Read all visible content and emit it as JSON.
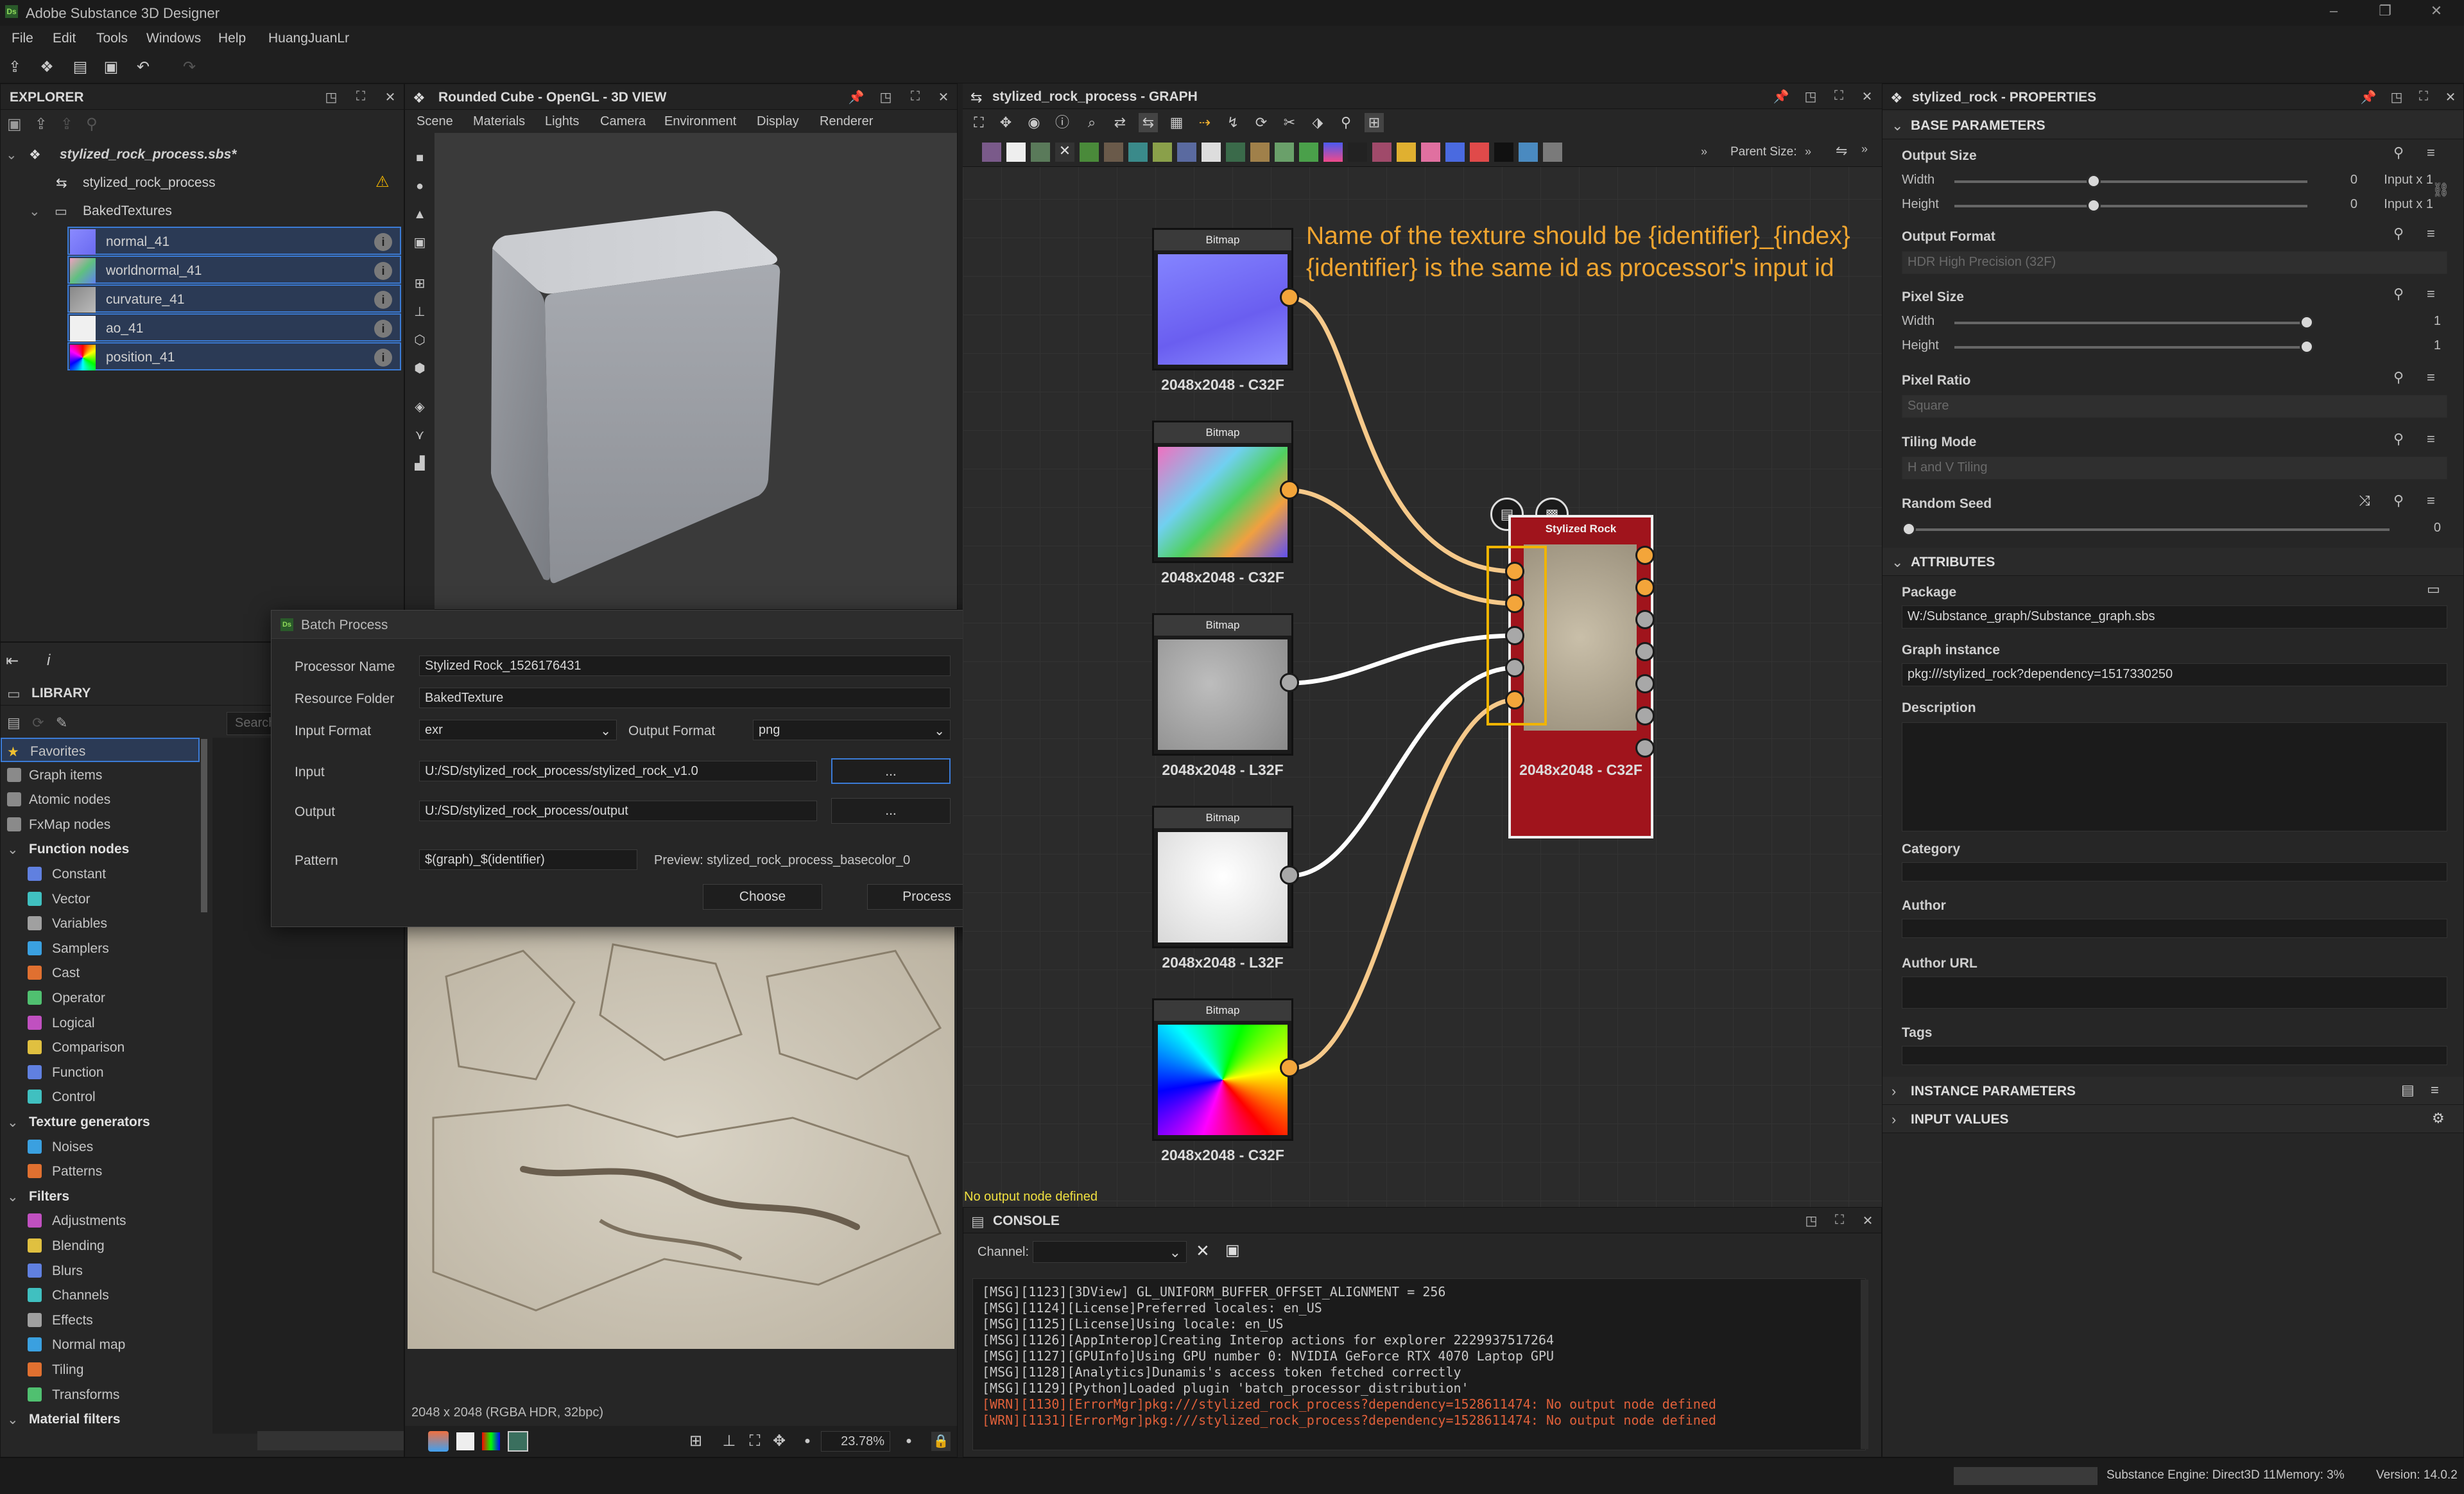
{
  "app": {
    "title": "Adobe Substance 3D Designer",
    "logo": "Ds"
  },
  "menu": [
    "File",
    "Edit",
    "Tools",
    "Windows",
    "Help",
    "HuangJuanLr"
  ],
  "explorer": {
    "title": "EXPLORER",
    "package": "stylized_rock_process.sbs*",
    "graph_item": "stylized_rock_process",
    "folder": "BakedTextures",
    "items": [
      {
        "label": "normal_41"
      },
      {
        "label": "worldnormal_41"
      },
      {
        "label": "curvature_41"
      },
      {
        "label": "ao_41"
      },
      {
        "label": "position_41"
      }
    ]
  },
  "view3d": {
    "title": "Rounded Cube - OpenGL - 3D VIEW",
    "menu": [
      "Scene",
      "Materials",
      "Lights",
      "Camera",
      "Environment",
      "Display",
      "Renderer"
    ]
  },
  "library": {
    "title": "LIBRARY",
    "search_placeholder": "Search",
    "items": [
      {
        "label": "Favorites",
        "type": "fav"
      },
      {
        "label": "Graph items",
        "type": "item"
      },
      {
        "label": "Atomic nodes",
        "type": "item"
      },
      {
        "label": "FxMap nodes",
        "type": "item"
      },
      {
        "label": "Function nodes",
        "type": "section"
      },
      {
        "label": "Constant",
        "type": "sub"
      },
      {
        "label": "Vector",
        "type": "sub"
      },
      {
        "label": "Variables",
        "type": "sub"
      },
      {
        "label": "Samplers",
        "type": "sub"
      },
      {
        "label": "Cast",
        "type": "sub"
      },
      {
        "label": "Operator",
        "type": "sub"
      },
      {
        "label": "Logical",
        "type": "sub"
      },
      {
        "label": "Comparison",
        "type": "sub"
      },
      {
        "label": "Function",
        "type": "sub"
      },
      {
        "label": "Control",
        "type": "sub"
      },
      {
        "label": "Texture generators",
        "type": "section"
      },
      {
        "label": "Noises",
        "type": "sub"
      },
      {
        "label": "Patterns",
        "type": "sub"
      },
      {
        "label": "Filters",
        "type": "section"
      },
      {
        "label": "Adjustments",
        "type": "sub"
      },
      {
        "label": "Blending",
        "type": "sub"
      },
      {
        "label": "Blurs",
        "type": "sub"
      },
      {
        "label": "Channels",
        "type": "sub"
      },
      {
        "label": "Effects",
        "type": "sub"
      },
      {
        "label": "Normal map",
        "type": "sub"
      },
      {
        "label": "Tiling",
        "type": "sub"
      },
      {
        "label": "Transforms",
        "type": "sub"
      },
      {
        "label": "Material filters",
        "type": "section"
      }
    ]
  },
  "view2d": {
    "info": "2048 x 2048 (RGBA HDR, 32bpc)",
    "zoom": "23.78%"
  },
  "graph": {
    "title": "stylized_rock_process - GRAPH",
    "parent_size_label": "Parent Size:",
    "annotation_line1": "Name of the texture should be {identifier}_{index}",
    "annotation_line2": "{identifier} is the same id as processor's input id",
    "nodes": [
      {
        "head": "Bitmap",
        "label": "2048x2048 - C32F"
      },
      {
        "head": "Bitmap",
        "label": "2048x2048 - C32F"
      },
      {
        "head": "Bitmap",
        "label": "2048x2048 - L32F"
      },
      {
        "head": "Bitmap",
        "label": "2048x2048 - L32F"
      },
      {
        "head": "Bitmap",
        "label": "2048x2048 - C32F"
      }
    ],
    "main_node": {
      "head": "Stylized Rock",
      "label": "2048x2048 - C32F"
    },
    "warning": "No output node defined"
  },
  "batch": {
    "title": "Batch Process",
    "processor_name_label": "Processor Name",
    "processor_name": "Stylized Rock_1526176431",
    "resource_folder_label": "Resource Folder",
    "resource_folder": "BakedTexture",
    "input_format_label": "Input Format",
    "input_format": "exr",
    "output_format_label": "Output Format",
    "output_format": "png",
    "input_label": "Input",
    "input": "U:/SD/stylized_rock_process/stylized_rock_v1.0",
    "output_label": "Output",
    "output": "U:/SD/stylized_rock_process/output",
    "browse": "...",
    "pattern_label": "Pattern",
    "pattern": "$(graph)_$(identifier)",
    "preview": "Preview: stylized_rock_process_basecolor_0",
    "choose": "Choose",
    "process": "Process"
  },
  "properties": {
    "title": "stylized_rock - PROPERTIES",
    "base_section": "BASE PARAMETERS",
    "output_size": "Output Size",
    "width": "Width",
    "height": "Height",
    "width_value": "0",
    "height_value": "0",
    "input_x1": "Input x 1",
    "output_format": "Output Format",
    "output_format_value": "HDR High Precision (32F)",
    "pixel_size": "Pixel Size",
    "pixel_width_value": "1",
    "pixel_height_value": "1",
    "pixel_ratio": "Pixel Ratio",
    "pixel_ratio_value": "Square",
    "tiling_mode": "Tiling Mode",
    "tiling_mode_value": "H and V Tiling",
    "random_seed": "Random Seed",
    "random_seed_value": "0",
    "attributes_section": "ATTRIBUTES",
    "package": "Package",
    "package_value": "W:/Substance_graph/Substance_graph.sbs",
    "graph_instance": "Graph instance",
    "graph_instance_value": "pkg:///stylized_rock?dependency=1517330250",
    "description": "Description",
    "category": "Category",
    "author": "Author",
    "author_url": "Author URL",
    "tags": "Tags",
    "instance_section": "INSTANCE PARAMETERS",
    "input_values_section": "INPUT VALUES"
  },
  "console": {
    "title": "CONSOLE",
    "channel_label": "Channel:",
    "lines": [
      {
        "kind": "msg",
        "text": "[MSG][1123][3DView]       GL_UNIFORM_BUFFER_OFFSET_ALIGNMENT = 256"
      },
      {
        "kind": "msg",
        "text": "[MSG][1124][License]Preferred locales: en_US"
      },
      {
        "kind": "msg",
        "text": "[MSG][1125][License]Using locale: en_US"
      },
      {
        "kind": "msg",
        "text": "[MSG][1126][AppInterop]Creating Interop actions for explorer 2229937517264"
      },
      {
        "kind": "msg",
        "text": "[MSG][1127][GPUInfo]Using GPU number 0: NVIDIA GeForce RTX 4070 Laptop GPU"
      },
      {
        "kind": "msg",
        "text": "[MSG][1128][Analytics]Dunamis's access token fetched correctly"
      },
      {
        "kind": "msg",
        "text": "[MSG][1129][Python]Loaded plugin 'batch_processor_distribution'"
      },
      {
        "kind": "warn",
        "text": "[WRN][1130][ErrorMgr]pkg:///stylized_rock_process?dependency=1528611474: No output node defined"
      },
      {
        "kind": "warn",
        "text": "[WRN][1131][ErrorMgr]pkg:///stylized_rock_process?dependency=1528611474: No output node defined"
      }
    ]
  },
  "status": {
    "engine": "Substance Engine: Direct3D 11",
    "memory": "Memory: 3%",
    "version": "Version: 14.0.2"
  },
  "colors": {
    "accent": "#3b7bd6",
    "wire_orange": "#f6c98a",
    "port_orange": "#f3a53a",
    "node_red": "#a0141c",
    "annotation": "#f0a530",
    "warning": "#e0603a"
  }
}
